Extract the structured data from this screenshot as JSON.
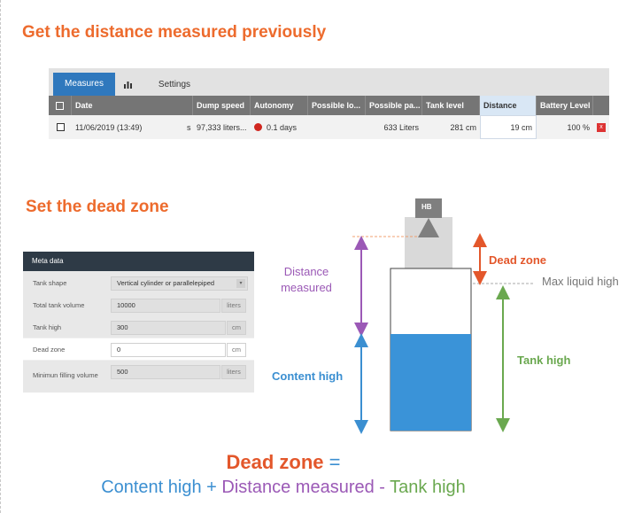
{
  "headings": {
    "top": "Get the distance measured previously",
    "middle": "Set the dead zone"
  },
  "measures": {
    "tabs": [
      {
        "label": "Measures",
        "icon": "bar-chart-icon"
      },
      {
        "label": "",
        "icon": "bar-chart-icon"
      },
      {
        "label": "Settings",
        "icon": ""
      }
    ],
    "columns": [
      "Date",
      "Dump speed",
      "Autonomy",
      "Possible lo...",
      "Possible pa...",
      "Tank level",
      "Distance",
      "Battery Level"
    ],
    "row": {
      "date": "11/06/2019 (13:49)",
      "marker": "s",
      "dump_speed": "97,333 liters...",
      "autonomy": "0.1 days",
      "possible_lo": "",
      "possible_pa": "633 Liters",
      "tank_level": "281 cm",
      "distance": "19 cm",
      "battery_level": "100 %",
      "delete": "x"
    },
    "status_color": "#d0261f",
    "accent": "#2f78bd"
  },
  "meta": {
    "title": "Meta data",
    "rows": [
      {
        "label": "Tank shape",
        "value": "Vertical cylinder or parallelepiped",
        "unit": ""
      },
      {
        "label": "Total tank volume",
        "value": "10000",
        "unit": "liters"
      },
      {
        "label": "Tank high",
        "value": "300",
        "unit": "cm"
      },
      {
        "label": "Dead zone",
        "value": "0",
        "unit": "cm"
      },
      {
        "label": "Minimun filling volume",
        "value": "500",
        "unit": "liters"
      }
    ]
  },
  "diagram": {
    "sensor": "HB",
    "distance_label": "Distance measured",
    "dead_zone_label": "Dead zone",
    "max_liquid_label": "Max liquid high",
    "content_label": "Content high",
    "tank_label": "Tank high"
  },
  "formula": {
    "title": "Dead zone",
    "eq": "=",
    "content": "Content high",
    "plus": "+",
    "distance": "Distance measured",
    "minus": "-",
    "tank": "Tank high"
  },
  "colors": {
    "orange": "#e3572b",
    "purple": "#9b59b6",
    "blue": "#3b8fd1",
    "green": "#6aa84f",
    "liquid": "#3a93d8"
  }
}
